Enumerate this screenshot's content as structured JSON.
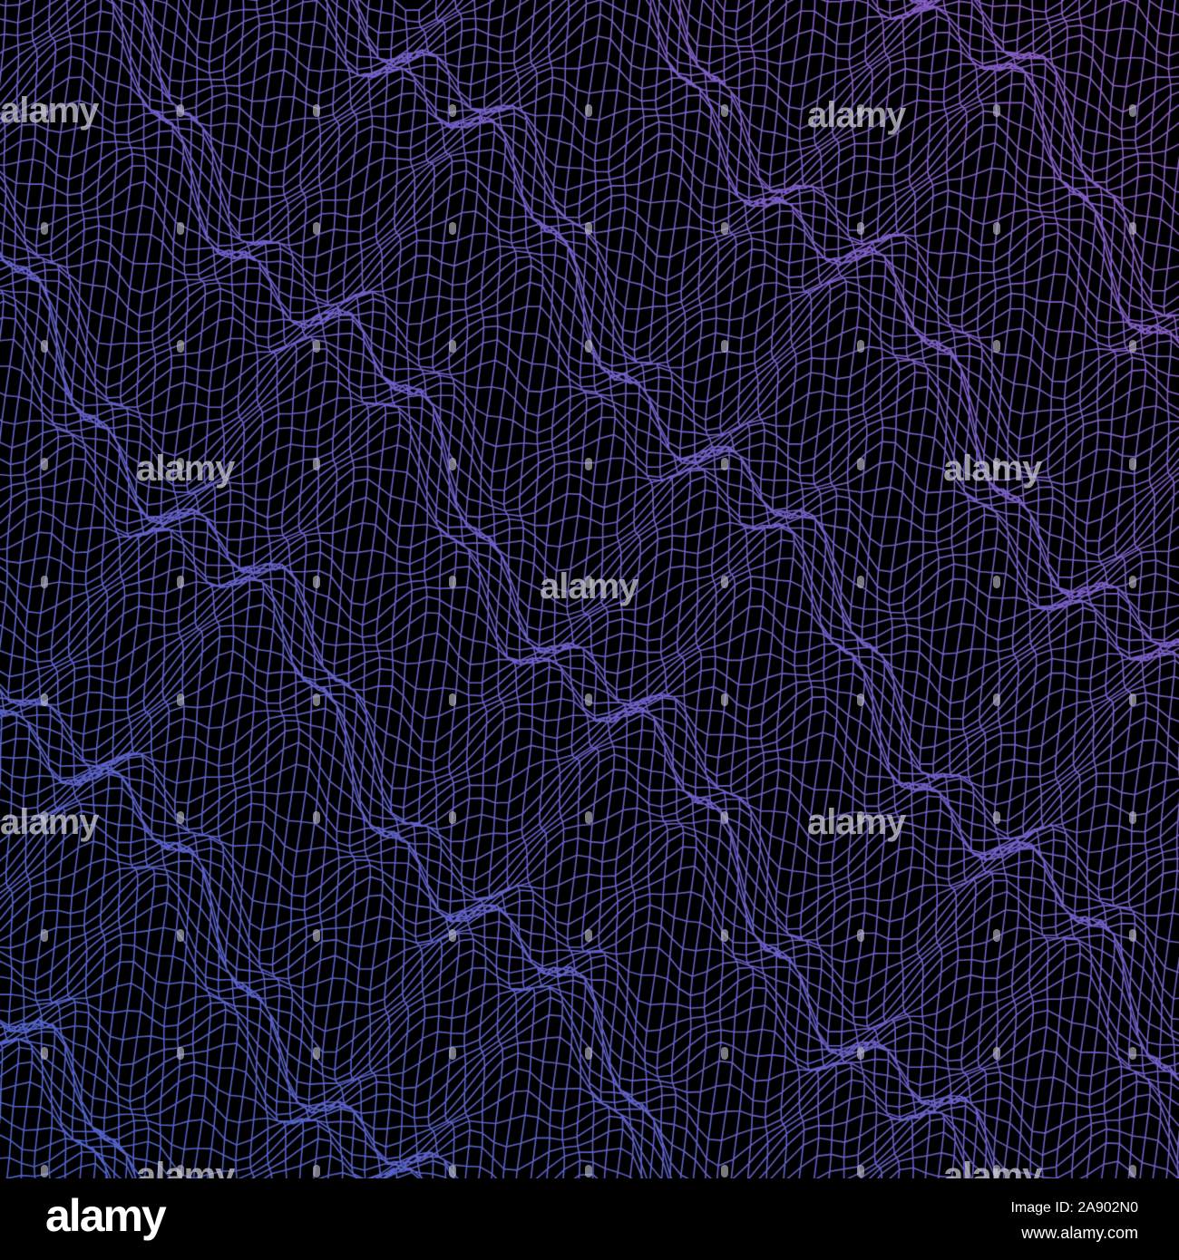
{
  "image": {
    "subject": "wireframe-terrain",
    "colors": {
      "background": "#000000",
      "line_start": "#4f63c8",
      "line_end": "#8a5ec4"
    }
  },
  "watermark": {
    "text": "alamy"
  },
  "footer": {
    "logo": "alamy",
    "image_id": "Image ID: 2A902N0",
    "website": "www.alamy.com"
  }
}
